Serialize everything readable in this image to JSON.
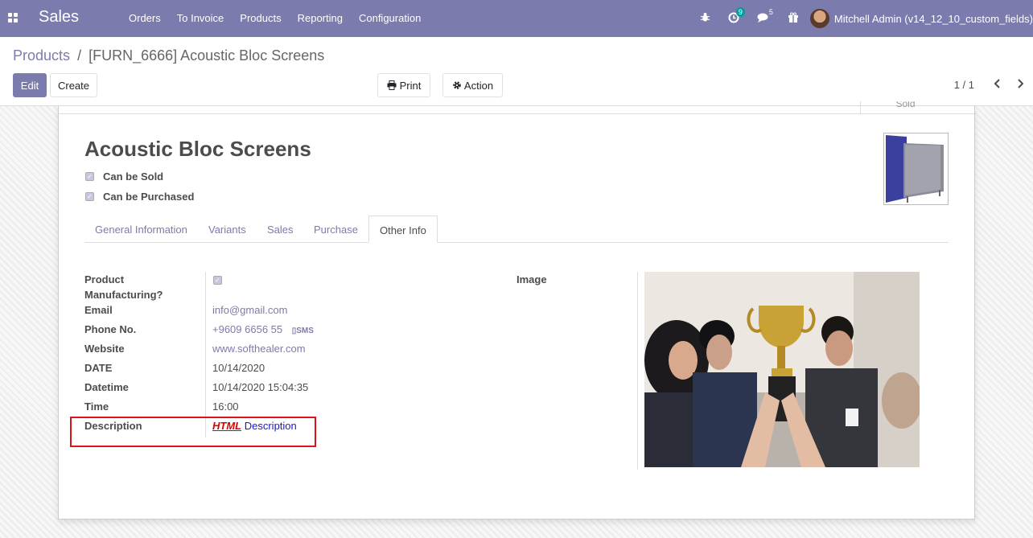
{
  "navbar": {
    "brand": "Sales",
    "menu": [
      "Orders",
      "To Invoice",
      "Products",
      "Reporting",
      "Configuration"
    ],
    "activity_count": "9",
    "message_count": "5",
    "user_name": "Mitchell Admin (v14_12_10_custom_fields)"
  },
  "breadcrumb": {
    "parent": "Products",
    "separator": "/",
    "current": "[FURN_6666] Acoustic Bloc Screens"
  },
  "buttons": {
    "edit": "Edit",
    "create": "Create",
    "print": "Print",
    "action": "Action"
  },
  "pager": {
    "value": "1 / 1"
  },
  "sheet": {
    "stat_label": "Sold",
    "title": "Acoustic Bloc Screens",
    "can_be_sold": "Can be Sold",
    "can_be_purchased": "Can be Purchased"
  },
  "tabs": [
    "General Information",
    "Variants",
    "Sales",
    "Purchase",
    "Other Info"
  ],
  "active_tab": "Other Info",
  "fields": {
    "product_manufacturing_label": "Product Manufacturing?",
    "email_label": "Email",
    "email_value": "info@gmail.com",
    "phone_label": "Phone No.",
    "phone_value": "+9609 6656 55",
    "sms_label": "SMS",
    "website_label": "Website",
    "website_value": "www.softhealer.com",
    "date_label": "DATE",
    "date_value": "10/14/2020",
    "datetime_label": "Datetime",
    "datetime_value": "10/14/2020 15:04:35",
    "time_label": "Time",
    "time_value": "16:00",
    "description_label": "Description",
    "description_html": "HTML",
    "description_text": "Description",
    "image_label": "Image"
  },
  "colors": {
    "brand": "#7c7bad",
    "highlight_box": "#d9141c",
    "html_text": "#e00000"
  }
}
